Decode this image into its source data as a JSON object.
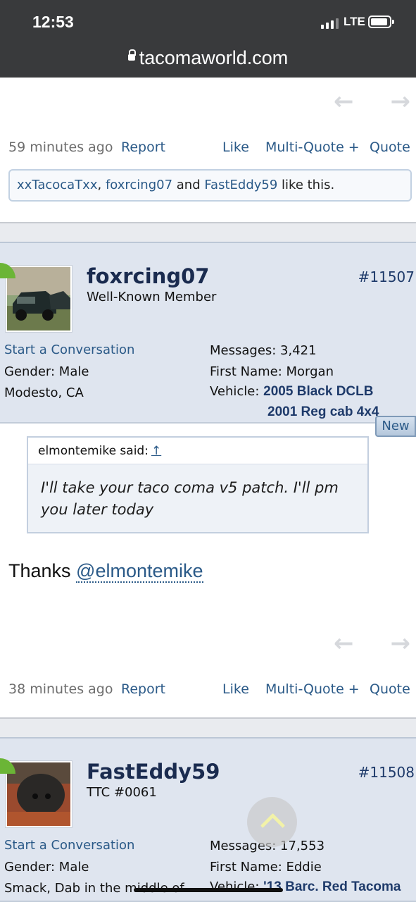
{
  "status": {
    "time": "12:53",
    "network": "LTE"
  },
  "browser": {
    "url": "tacomaworld.com"
  },
  "post_prev": {
    "time_ago": "59 minutes ago",
    "report": "Report",
    "like": "Like",
    "multiquote": "Multi-Quote +",
    "quote": "Quote",
    "likes": {
      "user1": "xxTacocaTxx",
      "sep1": ", ",
      "user2": "foxrcing07",
      "and": " and ",
      "user3": "FastEddy59",
      "tail": " like this."
    }
  },
  "post1": {
    "username": "foxrcing07",
    "user_title": "Well-Known Member",
    "post_number": "#11507",
    "start_conversation": "Start a Conversation",
    "gender": "Gender:  Male",
    "location": "Modesto, CA",
    "messages": "Messages:  3,421",
    "first_name": "First Name:  Morgan",
    "vehicle_label": "Vehicle: ",
    "vehicle_1": "2005 Black DCLB",
    "vehicle_2": "2001 Reg cab 4x4",
    "new_badge": "New",
    "quote": {
      "author": "elmontemike said:",
      "up_arrow": "↑",
      "text": "I'll take your taco coma v5 patch. I'll pm you later today"
    },
    "message": {
      "prefix": "Thanks ",
      "mention": "@elmontemike"
    },
    "time_ago": "38 minutes ago",
    "report": "Report",
    "like": "Like",
    "multiquote": "Multi-Quote +",
    "quote_label": "Quote"
  },
  "post2": {
    "username": "FastEddy59",
    "user_title": "TTC #0061",
    "post_number": "#11508",
    "start_conversation": "Start a Conversation",
    "gender": "Gender:  Male",
    "location": "Smack, Dab in the middle of",
    "messages": "Messages:  17,553",
    "first_name": "First Name:  Eddie",
    "vehicle_label": "Vehicle: ",
    "vehicle_1": "'13 Barc. Red Tacoma"
  },
  "colors": {
    "link": "#2b5a88",
    "header_bg": "#393a3c",
    "userbar_bg": "#dfe5ef",
    "badge_green": "#6bb536"
  }
}
